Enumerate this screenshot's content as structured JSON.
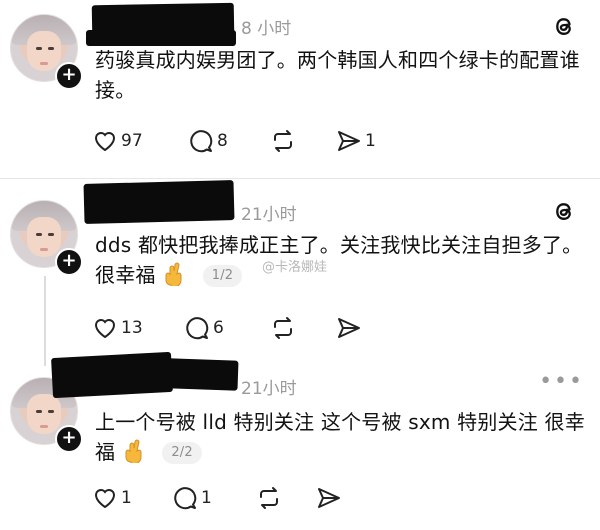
{
  "posts": [
    {
      "time": "8 小时",
      "text": "药骏真成内娱男团了。两个韩国人和四个绿卡的配置谁接。",
      "pager": "",
      "actions": {
        "likes": "97",
        "comments": "8",
        "reposts": "",
        "shares": "1"
      },
      "top_icon": "threads-logo-icon"
    },
    {
      "time": "21小时",
      "text": "dds 都快把我捧成正主了。关注我快比关注自担多了。很幸福",
      "pager": "1/2",
      "actions": {
        "likes": "13",
        "comments": "6",
        "reposts": "",
        "shares": ""
      },
      "top_icon": "threads-logo-icon"
    },
    {
      "time": "21小时",
      "text": "上一个号被 lld 特别关注 这个号被 sxm 特别关注 很幸福",
      "pager": "2/2",
      "actions": {
        "likes": "1",
        "comments": "1",
        "reposts": "",
        "shares": ""
      },
      "top_icon": "more-dots-icon"
    }
  ],
  "watermark": "@卡洛娜娃",
  "icons": {
    "like": "heart-icon",
    "comment": "comment-bubble-icon",
    "repost": "repost-arrows-icon",
    "share": "send-arrow-icon",
    "emoji": "crossed-fingers-emoji"
  },
  "colors": {
    "text": "#121212",
    "muted": "#9a9a9a",
    "badge_bg": "#f1f1f1",
    "emoji": "#f5b83b"
  }
}
